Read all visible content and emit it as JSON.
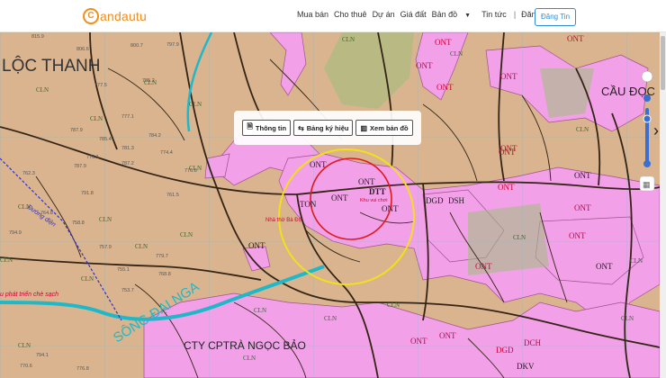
{
  "brand": {
    "logo_letter": "C",
    "name": "andautu"
  },
  "nav": {
    "items": [
      "Mua bán",
      "Cho thuê",
      "Dự án",
      "Giá đất",
      "Bản đồ",
      "Tin tức"
    ],
    "separator": "|",
    "login": "Đăng Nhập",
    "register": "Đăng Tin"
  },
  "toolbar": {
    "info": "Thông tin",
    "legend": "Bảng ký hiệu",
    "view_map": "Xem bản đồ"
  },
  "map": {
    "place_labels": {
      "loc_thanh": "LỘC THANH",
      "cau_doc": "CẦU ĐỌC",
      "song_dai_nga": "SÔNG ĐẠI NGA",
      "cty": "CTY CPTRÀ NGỌC BẢO",
      "duong_dien": "Đường điện",
      "phat_trien": "u phát triển chè sạch",
      "nha_ba": "Nhà thờ Bà Đội",
      "khu_vui_choi": "Khu vui chơi"
    },
    "zone_labels": [
      "ONT",
      "ONT",
      "ONT",
      "ONT",
      "ONT",
      "ONT",
      "ONT",
      "ONT",
      "ONT",
      "ONT",
      "ONT",
      "ONT",
      "ONT",
      "ONT",
      "ONT",
      "ONT",
      "ONT",
      "ONT",
      "ONT",
      "ONT",
      "DTT",
      "DGD",
      "DSH",
      "TON",
      "DKV",
      "DGD",
      "DCH",
      "CLN",
      "CLN",
      "CLN",
      "CLN",
      "CLN",
      "CLN",
      "CLN",
      "CLN",
      "CLN",
      "CLN",
      "CLN",
      "CLN",
      "CLN",
      "CLN",
      "CLN",
      "CLN",
      "CLN",
      "CLN",
      "CLN",
      "CLN",
      "CLN",
      "CLN"
    ],
    "elevations": [
      "815.9",
      "806.6",
      "800.7",
      "797.9",
      "777.5",
      "785.2",
      "777.1",
      "787.9",
      "785.4",
      "784.2",
      "781.3",
      "774.4",
      "776.1",
      "787.9",
      "787.2",
      "776.8",
      "762.3",
      "791.8",
      "764.8",
      "758.8",
      "761.5",
      "794.9",
      "757.9",
      "779.7",
      "755.1",
      "768.8",
      "753.7",
      "794.1",
      "776.8",
      "770.6"
    ]
  },
  "colors": {
    "brand": "#f28c1b",
    "terrain": "#d9b48e",
    "residential": "#f2a0e8",
    "residential_label": "#d4003a",
    "crop_label": "#2f6b2c",
    "river": "#1fb8c8",
    "circle_outer": "#f2e01a",
    "circle_inner": "#e01a1a",
    "road": "#332416",
    "power_line": "#3232c8",
    "login_button": "#2f8bd8"
  },
  "icons": [
    "info-icon",
    "legend-icon",
    "map-icon",
    "layers-icon",
    "zoom-slider-icon"
  ]
}
